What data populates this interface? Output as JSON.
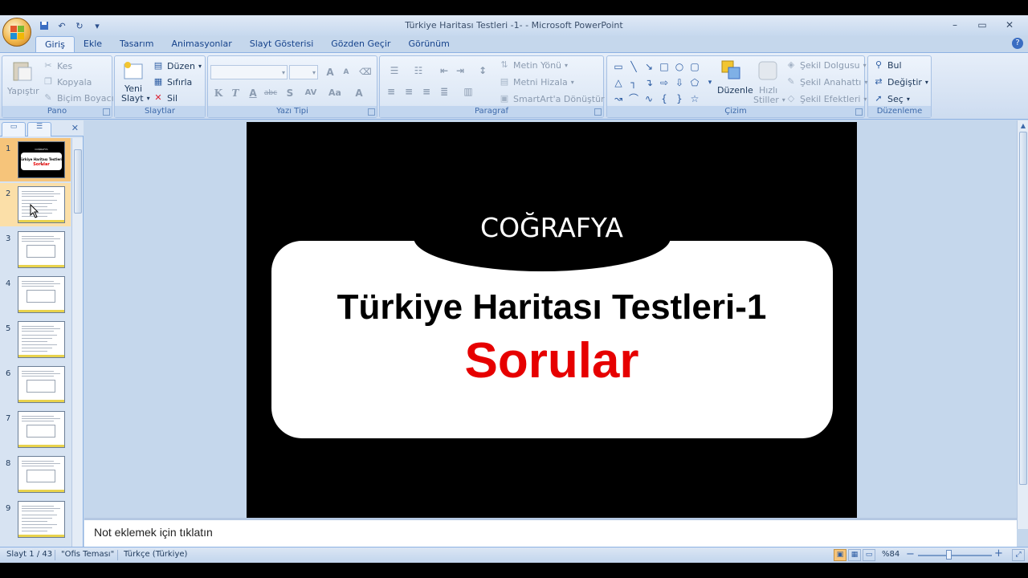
{
  "window": {
    "title": "Türkiye Haritası Testleri -1- - Microsoft PowerPoint",
    "minimize": "–",
    "maximize": "▭",
    "close": "✕"
  },
  "qat": {
    "save": "💾",
    "undo": "↶",
    "redo": "↻",
    "customize": "▾"
  },
  "tabs": [
    "Giriş",
    "Ekle",
    "Tasarım",
    "Animasyonlar",
    "Slayt Gösterisi",
    "Gözden Geçir",
    "Görünüm"
  ],
  "active_tab": "Giriş",
  "ribbon": {
    "pano": {
      "label": "Pano",
      "paste": "Yapıştır",
      "cut": "Kes",
      "copy": "Kopyala",
      "format_painter": "Biçim Boyacısı"
    },
    "slaytlar": {
      "label": "Slaytlar",
      "new_slide_1": "Yeni",
      "new_slide_2": "Slayt",
      "layout": "Düzen",
      "reset": "Sıfırla",
      "delete": "Sil"
    },
    "yazi_tipi": {
      "label": "Yazı Tipi",
      "bold": "K",
      "italic": "T",
      "underline": "A",
      "strike": "abc",
      "shadow": "S",
      "spacing": "AV",
      "case": "Aa",
      "color": "A",
      "grow": "A",
      "shrink": "A"
    },
    "paragraf": {
      "label": "Paragraf",
      "text_direction": "Metin Yönü",
      "align_text": "Metni Hizala",
      "smartart": "SmartArt'a Dönüştür"
    },
    "cizim": {
      "label": "Çizim",
      "arrange": "Düzenle",
      "quick_styles_1": "Hızlı",
      "quick_styles_2": "Stiller",
      "shape_fill": "Şekil Dolgusu",
      "shape_outline": "Şekil Anahattı",
      "shape_effects": "Şekil Efektleri"
    },
    "duzenleme": {
      "label": "Düzenleme",
      "find": "Bul",
      "replace": "Değiştir",
      "select": "Seç"
    }
  },
  "slides": [
    {
      "num": "1",
      "kind": "title",
      "mini_top": "COĞRAFYA",
      "mini_title": "Türkiye Haritası Testleri-1",
      "mini_red": "Sorular"
    },
    {
      "num": "2",
      "kind": "text"
    },
    {
      "num": "3",
      "kind": "map"
    },
    {
      "num": "4",
      "kind": "map"
    },
    {
      "num": "5",
      "kind": "text"
    },
    {
      "num": "6",
      "kind": "map"
    },
    {
      "num": "7",
      "kind": "map"
    },
    {
      "num": "8",
      "kind": "map"
    },
    {
      "num": "9",
      "kind": "text"
    }
  ],
  "selected_slide": "1",
  "slide": {
    "subtitle": "COĞRAFYA",
    "title": "Türkiye Haritası Testleri-1",
    "subtitle2": "Sorular"
  },
  "notes": {
    "placeholder": "Not eklemek için tıklatın"
  },
  "status": {
    "slide_counter": "Slayt 1 / 43",
    "theme": "\"Ofis Teması\"",
    "language": "Türkçe (Türkiye)",
    "zoom": "%84",
    "zoom_out": "−",
    "zoom_in": "+"
  },
  "colors": {
    "accent_red": "#e60000",
    "ribbon_bg": "#dce7f5",
    "selected": "#f6c47a"
  }
}
